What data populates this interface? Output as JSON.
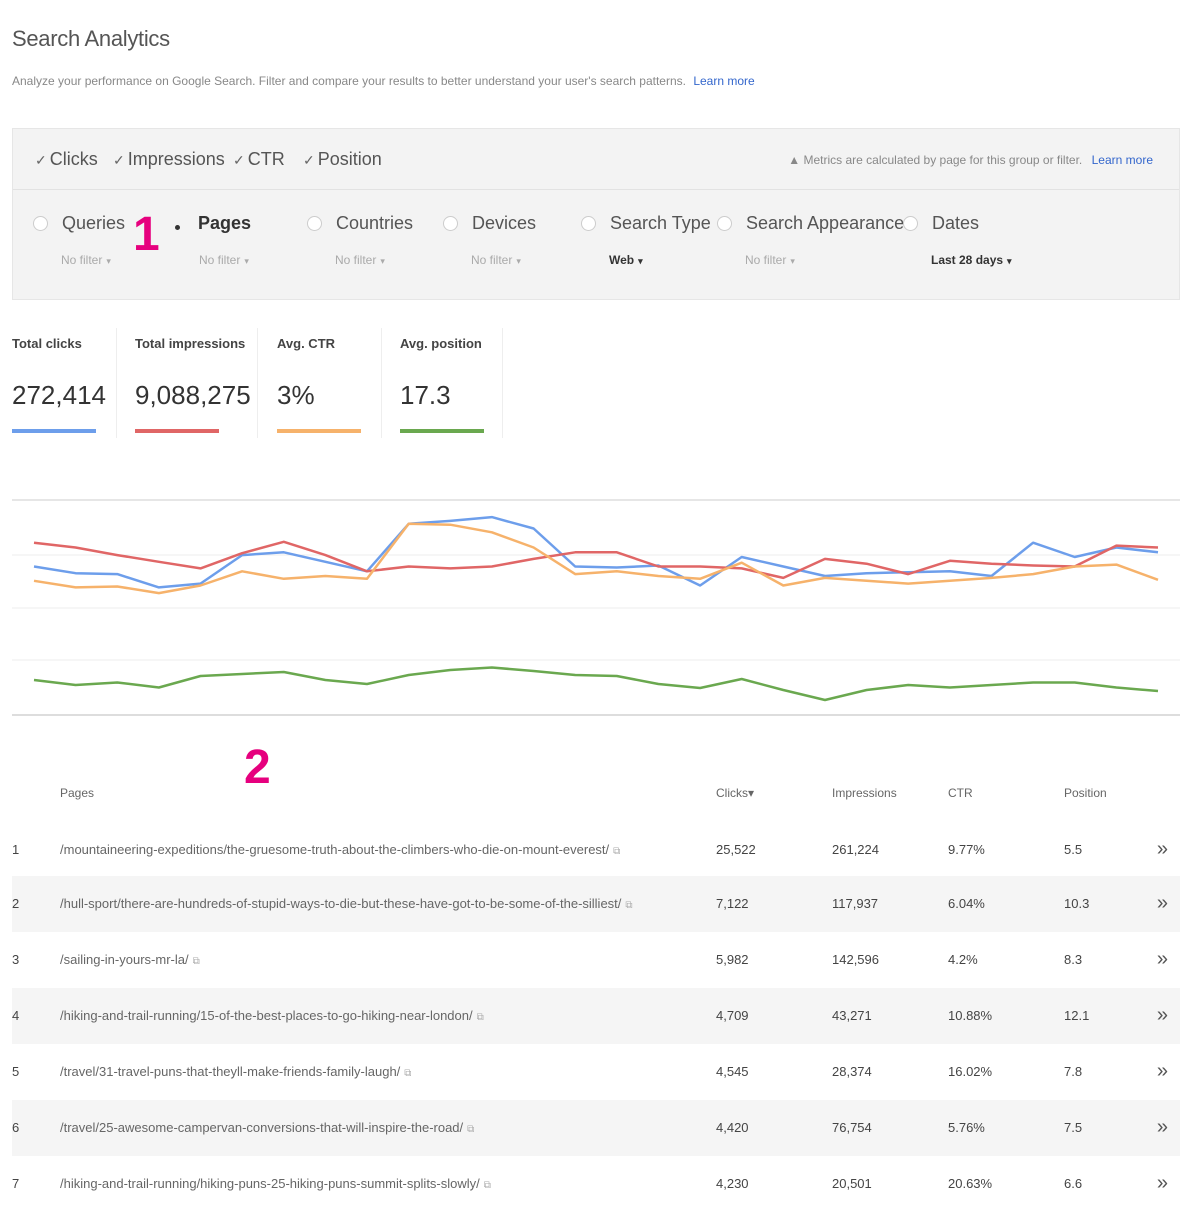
{
  "page": {
    "title": "Search Analytics",
    "subtitle": "Analyze your performance on Google Search. Filter and compare your results to better understand your user's search patterns.",
    "learn_more": "Learn more"
  },
  "metrics_toggle": [
    {
      "label": "Clicks",
      "checked": true
    },
    {
      "label": "Impressions",
      "checked": true
    },
    {
      "label": "CTR",
      "checked": true
    },
    {
      "label": "Position",
      "checked": true
    }
  ],
  "metrics_note": "Metrics are calculated by page for this group or filter.",
  "metrics_note_link": "Learn more",
  "filters": [
    {
      "label": "Queries",
      "value": "No filter",
      "selected": false
    },
    {
      "label": "Pages",
      "value": "No filter",
      "selected": true
    },
    {
      "label": "Countries",
      "value": "No filter",
      "selected": false
    },
    {
      "label": "Devices",
      "value": "No filter",
      "selected": false
    },
    {
      "label": "Search Type",
      "value": "Web",
      "selected": false
    },
    {
      "label": "Search Appearance",
      "value": "No filter",
      "selected": false
    },
    {
      "label": "Dates",
      "value": "Last 28 days",
      "selected": false
    }
  ],
  "annotations": {
    "one": "1",
    "two": "2"
  },
  "totals": [
    {
      "label": "Total clicks",
      "value": "272,414",
      "color": "#6d9eeb"
    },
    {
      "label": "Total impressions",
      "value": "9,088,275",
      "color": "#e06666"
    },
    {
      "label": "Avg. CTR",
      "value": "3%",
      "color": "#f6b26b"
    },
    {
      "label": "Avg. position",
      "value": "17.3",
      "color": "#6aa84f"
    }
  ],
  "chart_data": {
    "type": "line",
    "x": [
      1,
      2,
      3,
      4,
      5,
      6,
      7,
      8,
      9,
      10,
      11,
      12,
      13,
      14,
      15,
      16,
      17,
      18,
      19,
      20,
      21,
      22,
      23,
      24,
      25,
      26,
      27,
      28
    ],
    "series": [
      {
        "name": "Total clicks",
        "color": "#6d9eeb",
        "values": [
          0.3,
          0.23,
          0.22,
          0.08,
          0.12,
          0.42,
          0.45,
          0.35,
          0.25,
          0.75,
          0.78,
          0.82,
          0.7,
          0.3,
          0.29,
          0.31,
          0.1,
          0.4,
          0.3,
          0.2,
          0.23,
          0.24,
          0.25,
          0.2,
          0.55,
          0.4,
          0.5,
          0.45
        ]
      },
      {
        "name": "Total impressions",
        "color": "#e06666",
        "values": [
          0.55,
          0.5,
          0.42,
          0.35,
          0.28,
          0.44,
          0.56,
          0.42,
          0.25,
          0.3,
          0.28,
          0.3,
          0.38,
          0.45,
          0.45,
          0.3,
          0.3,
          0.28,
          0.18,
          0.38,
          0.33,
          0.22,
          0.36,
          0.33,
          0.31,
          0.3,
          0.52,
          0.5
        ]
      },
      {
        "name": "Avg. CTR",
        "color": "#f6b26b",
        "values": [
          0.15,
          0.08,
          0.09,
          0.02,
          0.1,
          0.25,
          0.17,
          0.2,
          0.17,
          0.75,
          0.74,
          0.66,
          0.5,
          0.22,
          0.25,
          0.2,
          0.17,
          0.34,
          0.1,
          0.18,
          0.15,
          0.12,
          0.15,
          0.18,
          0.22,
          0.3,
          0.32,
          0.16
        ]
      },
      {
        "name": "Avg. position",
        "color": "#6aa84f",
        "values": [
          0.6,
          0.5,
          0.55,
          0.45,
          0.68,
          0.72,
          0.76,
          0.6,
          0.52,
          0.7,
          0.8,
          0.85,
          0.78,
          0.7,
          0.68,
          0.52,
          0.44,
          0.62,
          0.4,
          0.2,
          0.4,
          0.5,
          0.45,
          0.5,
          0.55,
          0.55,
          0.45,
          0.38
        ]
      }
    ]
  },
  "table": {
    "headers": {
      "pages": "Pages",
      "clicks": "Clicks",
      "impressions": "Impressions",
      "ctr": "CTR",
      "position": "Position"
    },
    "rows": [
      {
        "rank": "1",
        "page": "/mountaineering-expeditions/the-gruesome-truth-about-the-climbers-who-die-on-mount-everest/",
        "clicks": "25,522",
        "impressions": "261,224",
        "ctr": "9.77%",
        "position": "5.5"
      },
      {
        "rank": "2",
        "page": "/hull-sport/there-are-hundreds-of-stupid-ways-to-die-but-these-have-got-to-be-some-of-the-silliest/",
        "clicks": "7,122",
        "impressions": "117,937",
        "ctr": "6.04%",
        "position": "10.3"
      },
      {
        "rank": "3",
        "page": "/sailing-in-yours-mr-la/",
        "clicks": "5,982",
        "impressions": "142,596",
        "ctr": "4.2%",
        "position": "8.3"
      },
      {
        "rank": "4",
        "page": "/hiking-and-trail-running/15-of-the-best-places-to-go-hiking-near-london/",
        "clicks": "4,709",
        "impressions": "43,271",
        "ctr": "10.88%",
        "position": "12.1"
      },
      {
        "rank": "5",
        "page": "/travel/31-travel-puns-that-theyll-make-friends-family-laugh/",
        "clicks": "4,545",
        "impressions": "28,374",
        "ctr": "16.02%",
        "position": "7.8"
      },
      {
        "rank": "6",
        "page": "/travel/25-awesome-campervan-conversions-that-will-inspire-the-road/",
        "clicks": "4,420",
        "impressions": "76,754",
        "ctr": "5.76%",
        "position": "7.5"
      },
      {
        "rank": "7",
        "page": "/hiking-and-trail-running/hiking-puns-25-hiking-puns-summit-splits-slowly/",
        "clicks": "4,230",
        "impressions": "20,501",
        "ctr": "20.63%",
        "position": "6.6"
      }
    ]
  }
}
